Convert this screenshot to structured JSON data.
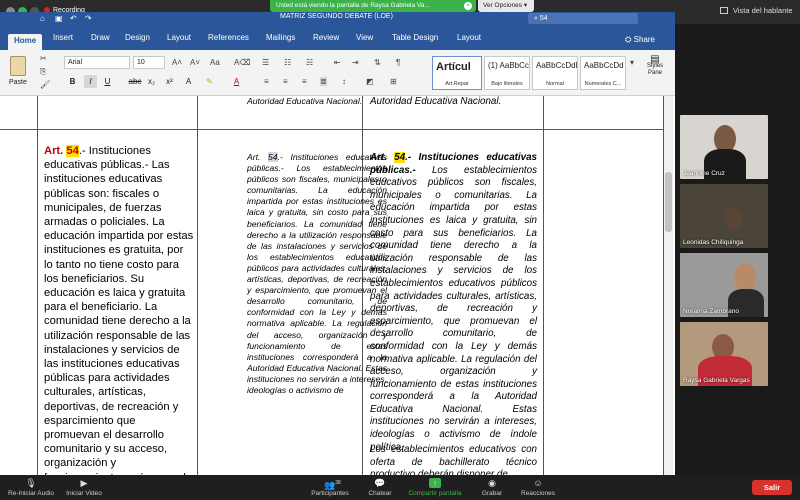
{
  "zoom": {
    "recording_label": "Recording",
    "share_banner": "Usted está viendo la pantalla de Raysa Gabriela Va...",
    "view_options": "Ver Opciones",
    "speaker_view": "Vista del hablante",
    "toolbar": {
      "unmute": "Re-Iniciar Audio",
      "start_video": "Iniciar Video",
      "participants": "Participantes",
      "participants_count": "38",
      "chat": "Chatear",
      "share_screen": "Compartir pantalla",
      "record": "Grabar",
      "reactions": "Reacciones",
      "leave": "Salir"
    },
    "participants": [
      {
        "name": "Jeannine Cruz"
      },
      {
        "name": "Leonidas Chiliquinga"
      },
      {
        "name": "Noralma Zambrano"
      },
      {
        "name": "Raysa Gabriela Vargas"
      }
    ]
  },
  "word": {
    "doc_title": "MATRIZ SEGUNDO DEBATE (LOE)",
    "search_value": "54",
    "tabs": [
      "Home",
      "Insert",
      "Draw",
      "Design",
      "Layout",
      "References",
      "Mailings",
      "Review",
      "View",
      "Table Design",
      "Layout"
    ],
    "active_tab": "Home",
    "share_label": "Share",
    "font_name": "Arial",
    "font_size": "10",
    "paste_label": "Paste",
    "styles": [
      {
        "sample": "Artícul",
        "label": "Art.Repar"
      },
      {
        "sample": "(1)  AaBbCcI",
        "label": "Bajo literales"
      },
      {
        "sample": "AaBbCcDdEe",
        "label": "Normal"
      },
      {
        "sample": "AaBbCcDd",
        "label": "Numerales C..."
      }
    ],
    "styles_pane": "Styles Pane",
    "doc": {
      "top_mid": "Autoridad Educativa Nacional.",
      "top_right": "Autoridad Educativa Nacional.",
      "col1": {
        "art": "Art. ",
        "num": "54",
        "text": ".- Instituciones educativas públicas.- Las instituciones educativas públicas son: fiscales o municipales, de fuerzas armadas o policiales. La educación impartida por estas instituciones es gratuita, por lo tanto no tiene costo para los beneficiarios. Su educación es laica y gratuita para el beneficiario. La comunidad tiene derecho a la utilización responsable de las instalaciones y servicios de las instituciones educativas públicas para actividades culturales, artísticas, deportivas, de recreación y esparcimiento que promuevan el desarrollo comunitario y su acceso, organización y funcionamiento será normado en el Reglamento respectivo."
      },
      "col2": {
        "art": "Art. ",
        "num": "54",
        "text": ".- Instituciones educativas públicas.- Los establecimientos públicos son fiscales, municipales o comunitarias. La educación impartida por estas instituciones es laica y gratuita, sin costo para sus beneficiarios. La comunidad tiene derecho a la utilización responsable de las instalaciones y servicios de los establecimientos educativos públicos para actividades culturales, artísticas, deportivas, de recreación y esparcimiento, que promuevan el desarrollo comunitario, de conformidad con la Ley y demás normativa aplicable. La regulación del acceso, organización y funcionamiento de estas instituciones corresponderá a la Autoridad Educativa Nacional. Estas instituciones no servirán a intereses, ideologías o activismo de"
      },
      "col3": {
        "art": "Art. ",
        "num": "54",
        "title": ".- Instituciones educativas públicas.-",
        "text": " Los establecimientos educativos públicos son fiscales, municipales o comunitarias. La educación impartida por estas instituciones es laica y gratuita, sin costo para sus beneficiarios. La comunidad tiene derecho a la utilización responsable de las instalaciones y servicios de los establecimientos educativos públicos para actividades culturales, artísticas, deportivas, de recreación y esparcimiento, que promuevan el desarrollo comunitario, de conformidad con la Ley y demás normativa aplicable. La regulación del acceso, organización y funcionamiento de estas instituciones corresponderá a la Autoridad Educativa Nacional. Estas instituciones no servirán a intereses, ideologías o activismo de índole política.",
        "text2": "Los establecimientos educativos con oferta de bachillerato técnico productivo deberán disponer de"
      }
    }
  },
  "colors": {
    "word_blue": "#2b579a",
    "zoom_green": "#3cb24a",
    "leave_red": "#d9312b"
  }
}
